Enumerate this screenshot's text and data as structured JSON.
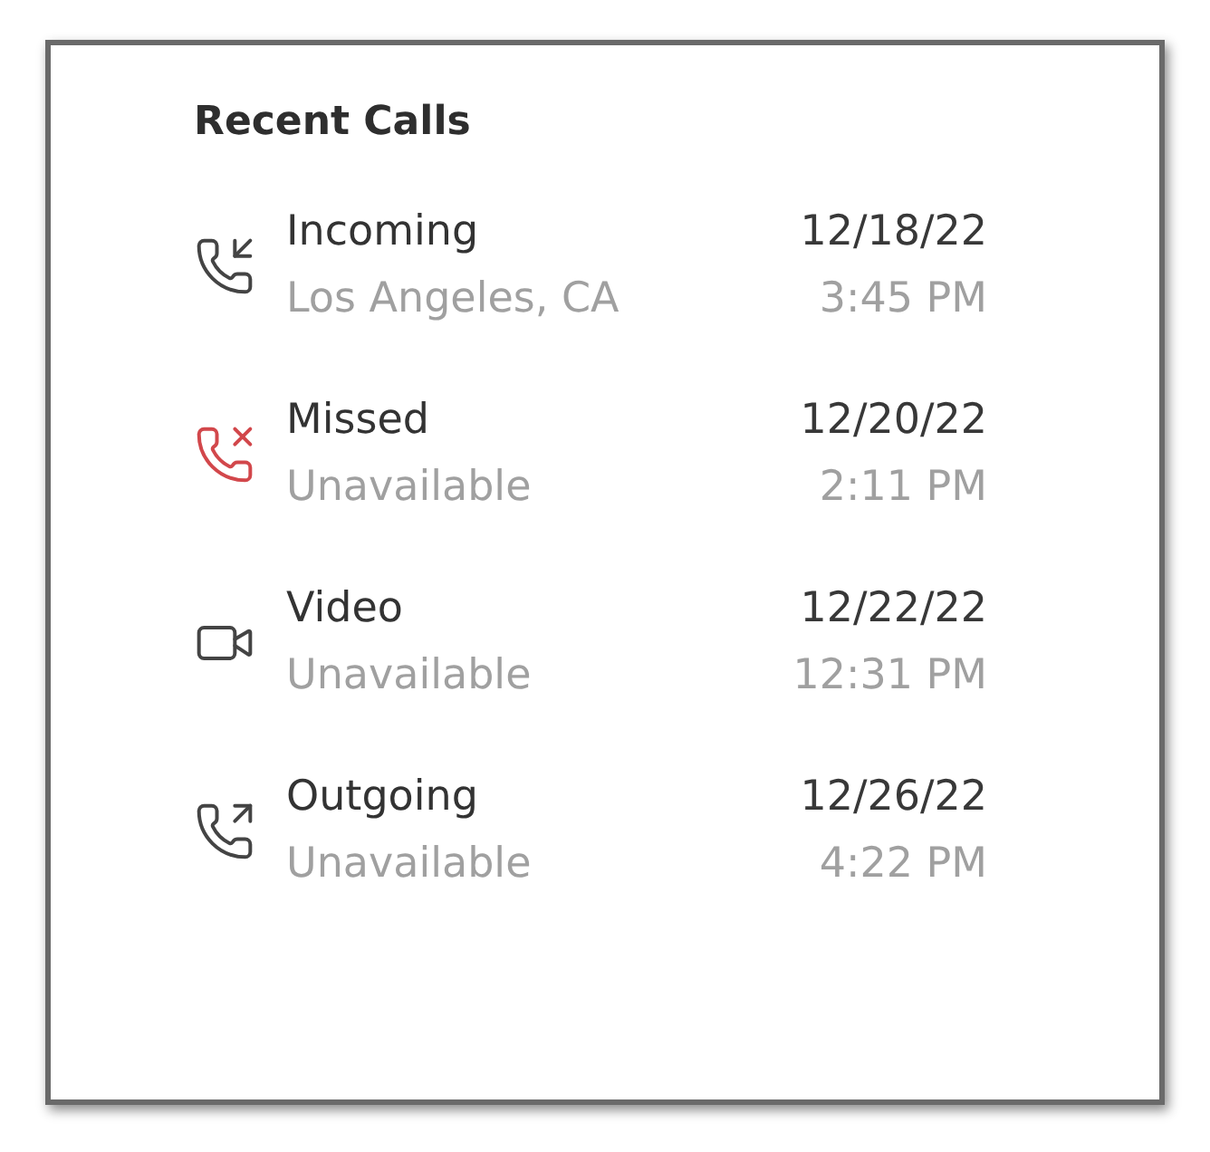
{
  "title": "Recent Calls",
  "calls": [
    {
      "kind": "incoming",
      "label": "Incoming",
      "location": "Los Angeles, CA",
      "date": "12/18/22",
      "time": "3:45 PM"
    },
    {
      "kind": "missed",
      "label": "Missed",
      "location": "Unavailable",
      "date": "12/20/22",
      "time": "2:11 PM"
    },
    {
      "kind": "video",
      "label": "Video",
      "location": "Unavailable",
      "date": "12/22/22",
      "time": "12:31 PM"
    },
    {
      "kind": "outgoing",
      "label": "Outgoing",
      "location": "Unavailable",
      "date": "12/26/22",
      "time": "4:22 PM"
    }
  ]
}
